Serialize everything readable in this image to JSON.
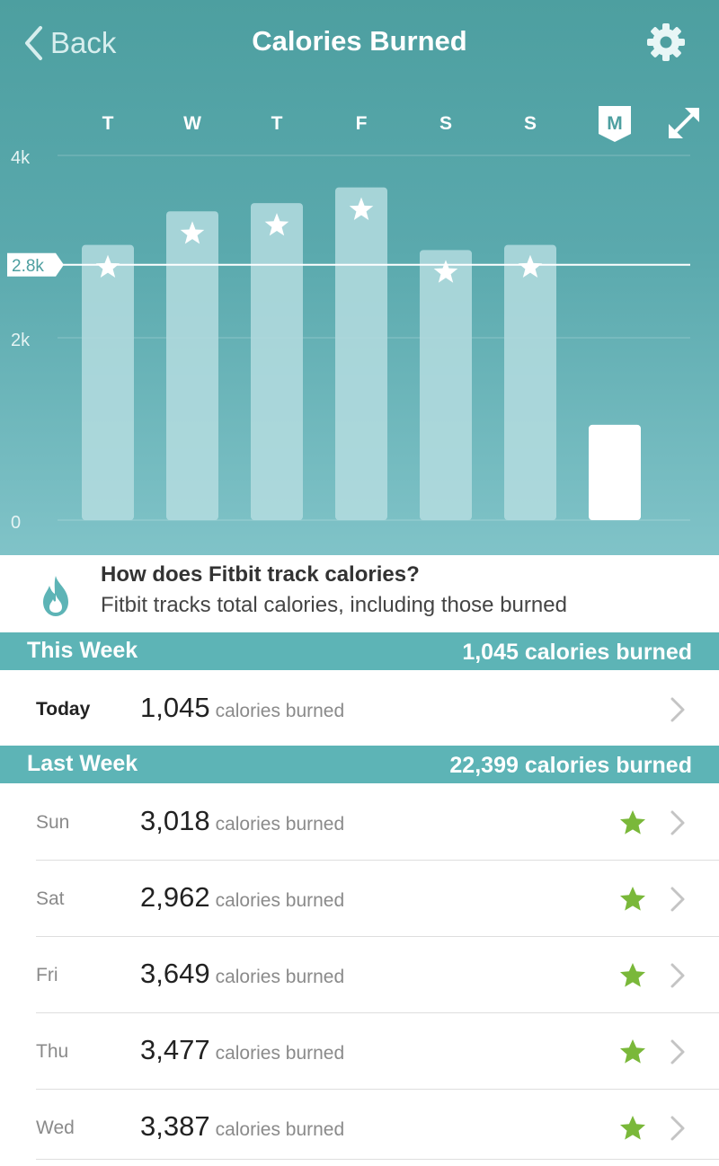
{
  "header": {
    "back_label": "Back",
    "title": "Calories Burned",
    "settings_icon": "gear-icon",
    "expand_icon": "expand-icon"
  },
  "colors": {
    "accent": "#5db4b6",
    "bar": "#b4dcdf",
    "bar_current": "#ffffff",
    "goal_star": "#7ab83a"
  },
  "chart_data": {
    "type": "bar",
    "categories": [
      "T",
      "W",
      "T",
      "F",
      "S",
      "S",
      "M"
    ],
    "values": [
      3018,
      3387,
      3477,
      3649,
      2962,
      3018,
      1045
    ],
    "current_index": 6,
    "goal_met": [
      true,
      true,
      true,
      true,
      true,
      true,
      false
    ],
    "ylim": [
      0,
      4000
    ],
    "yticks": [
      {
        "value": 0,
        "label": "0"
      },
      {
        "value": 2000,
        "label": "2k"
      },
      {
        "value": 4000,
        "label": "4k"
      }
    ],
    "goal": {
      "value": 2800,
      "label": "2.8k"
    },
    "grid": true
  },
  "info": {
    "title": "How does Fitbit track calories?",
    "text": "Fitbit tracks total calories, including those burned"
  },
  "this_week": {
    "label": "This Week",
    "total": "1,045 calories burned",
    "rows": [
      {
        "day": "Today",
        "value": "1,045",
        "unit": "calories burned",
        "goal_met": false
      }
    ]
  },
  "last_week": {
    "label": "Last Week",
    "total": "22,399 calories burned",
    "rows": [
      {
        "day": "Sun",
        "value": "3,018",
        "unit": "calories burned",
        "goal_met": true
      },
      {
        "day": "Sat",
        "value": "2,962",
        "unit": "calories burned",
        "goal_met": true
      },
      {
        "day": "Fri",
        "value": "3,649",
        "unit": "calories burned",
        "goal_met": true
      },
      {
        "day": "Thu",
        "value": "3,477",
        "unit": "calories burned",
        "goal_met": true
      },
      {
        "day": "Wed",
        "value": "3,387",
        "unit": "calories burned",
        "goal_met": true
      }
    ]
  }
}
